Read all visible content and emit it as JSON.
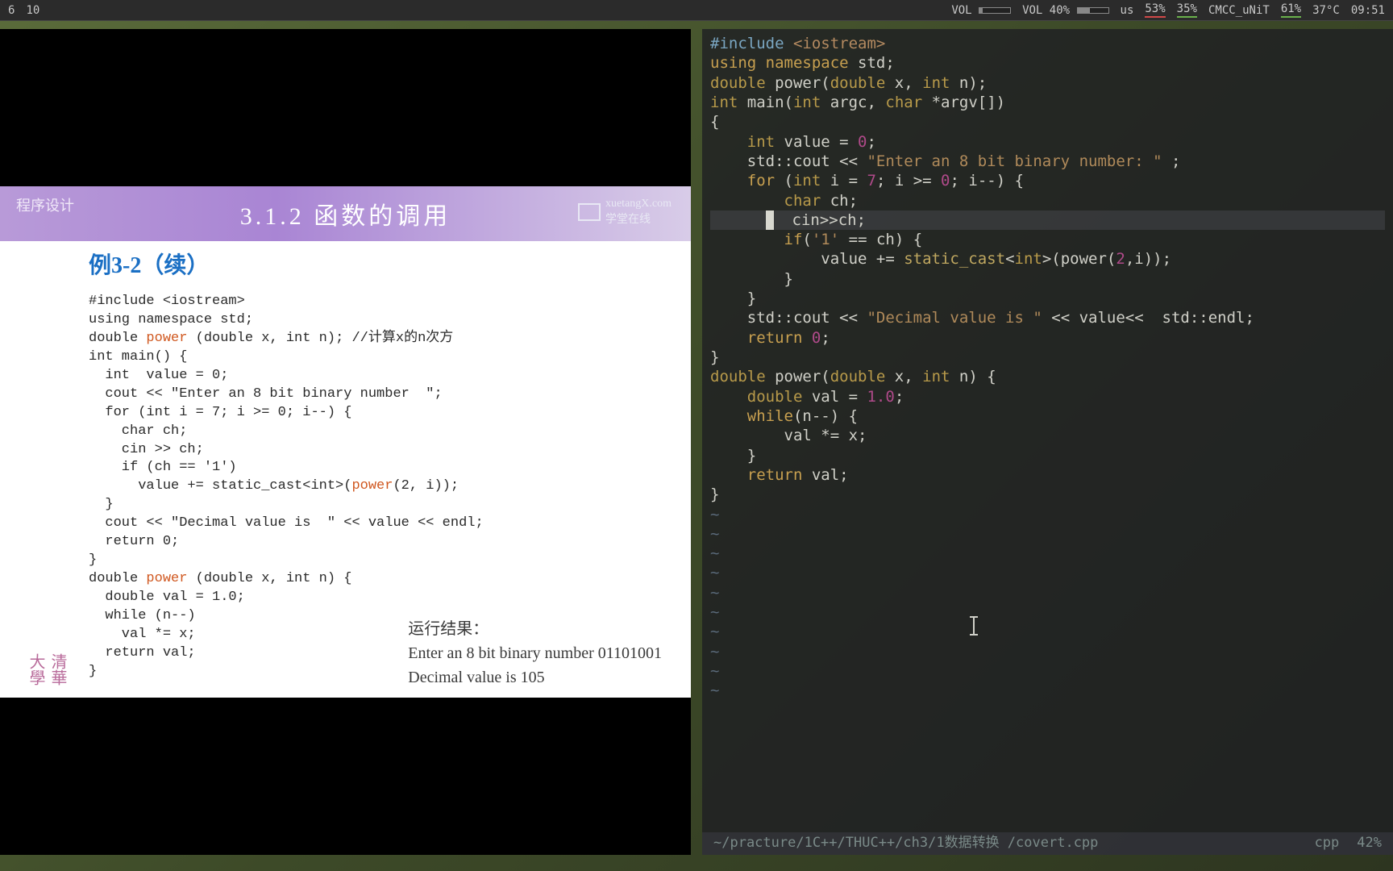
{
  "statusbar": {
    "workspace_current": "6",
    "workspace_count": "10",
    "vol_label": "VOL",
    "vol_pct_label": "VOL 40%",
    "kbd_layout": "us",
    "cpu_pct": "53%",
    "mem_pct": "35%",
    "net_name": "CMCC_uNiT",
    "batt_pct": "61%",
    "temp": "37°C",
    "clock": "09:51"
  },
  "slide": {
    "crumb": "程序设计",
    "title": "3.1.2 函数的调用",
    "logo_text": "xuetangX.com",
    "logo_cn": "学堂在线",
    "subtitle": "例3-2（续）",
    "code": [
      "#include <iostream>",
      "using namespace std;",
      "",
      "double power (double x, int n); //计算x的n次方",
      "",
      "int main() {",
      "  int  value = 0;",
      "  cout << \"Enter an 8 bit binary number  \";",
      "  for (int i = 7; i >= 0; i--) {",
      "    char ch;",
      "    cin >> ch;",
      "    if (ch == '1')",
      "      value += static_cast<int>(power(2, i));",
      "  }",
      "  cout << \"Decimal value is  \" << value << endl;",
      "  return 0;",
      "}",
      "",
      "double power (double x, int n) {",
      "  double val = 1.0;",
      "  while (n--)",
      "    val *= x;",
      "  return val;",
      "}"
    ],
    "result_label": "运行结果：",
    "result_line1": "Enter an 8 bit binary number  01101001",
    "result_line2": "Decimal value is  105",
    "uni": "清華大學"
  },
  "editor": {
    "cursor_line_index": 10,
    "lines": [
      [
        [
          "kw-pp",
          "#include "
        ],
        [
          "kw-inc",
          "<iostream>"
        ]
      ],
      [
        [
          "kw-key",
          "using "
        ],
        [
          "kw-key",
          "namespace "
        ],
        [
          "",
          "std;"
        ]
      ],
      [
        [
          "",
          ""
        ]
      ],
      [
        [
          "kw-type",
          "double "
        ],
        [
          "",
          "power("
        ],
        [
          "kw-type",
          "double"
        ],
        [
          "",
          "",
          " x, "
        ],
        [
          "kw-type",
          "int"
        ],
        [
          "",
          " n);"
        ]
      ],
      [
        [
          "",
          ""
        ]
      ],
      [
        [
          "kw-type",
          "int "
        ],
        [
          "",
          "main("
        ],
        [
          "kw-type",
          "int"
        ],
        [
          "",
          " argc, "
        ],
        [
          "kw-type",
          "char"
        ],
        [
          "",
          " *argv[])"
        ]
      ],
      [
        [
          "",
          "{"
        ]
      ],
      [
        [
          "",
          "    "
        ],
        [
          "kw-type",
          "int"
        ],
        [
          "",
          " value = "
        ],
        [
          "kw-num",
          "0"
        ],
        [
          "",
          ";"
        ]
      ],
      [
        [
          "",
          "    std::cout << "
        ],
        [
          "kw-str",
          "\"Enter an 8 bit binary number: \""
        ],
        [
          "",
          " ;"
        ]
      ],
      [
        [
          "",
          "    "
        ],
        [
          "kw-key",
          "for"
        ],
        [
          "",
          " ("
        ],
        [
          "kw-type",
          "int"
        ],
        [
          "",
          " i = "
        ],
        [
          "kw-num",
          "7"
        ],
        [
          "",
          "; i >= "
        ],
        [
          "kw-num",
          "0"
        ],
        [
          "",
          "; i--) {"
        ]
      ],
      [
        [
          "",
          "        "
        ],
        [
          "kw-type",
          "char"
        ],
        [
          "",
          " ch;"
        ]
      ],
      [
        [
          "",
          "        cin>>ch;"
        ]
      ],
      [
        [
          "",
          "        "
        ],
        [
          "kw-key",
          "if"
        ],
        [
          "",
          "("
        ],
        [
          "kw-str",
          "'1'"
        ],
        [
          "",
          " == ch) {"
        ]
      ],
      [
        [
          "",
          "            value += "
        ],
        [
          "kw-call",
          "static_cast"
        ],
        [
          "",
          "<"
        ],
        [
          "kw-type",
          "int"
        ],
        [
          "",
          ">(power("
        ],
        [
          "kw-num",
          "2"
        ],
        [
          "",
          ",i));"
        ]
      ],
      [
        [
          "",
          "        }"
        ]
      ],
      [
        [
          "",
          "    }"
        ]
      ],
      [
        [
          "",
          "    std::cout << "
        ],
        [
          "kw-str",
          "\"Decimal value is \""
        ],
        [
          "",
          " << value<<  std::endl;"
        ]
      ],
      [
        [
          "",
          ""
        ]
      ],
      [
        [
          "",
          "    "
        ],
        [
          "kw-key",
          "return"
        ],
        [
          "",
          " "
        ],
        [
          "kw-num",
          "0"
        ],
        [
          "",
          ";"
        ]
      ],
      [
        [
          "",
          "}"
        ]
      ],
      [
        [
          "",
          ""
        ]
      ],
      [
        [
          "kw-type",
          "double "
        ],
        [
          "",
          "power("
        ],
        [
          "kw-type",
          "double"
        ],
        [
          "",
          " x, "
        ],
        [
          "kw-type",
          "int"
        ],
        [
          "",
          " n) {"
        ]
      ],
      [
        [
          "",
          "    "
        ],
        [
          "kw-type",
          "double"
        ],
        [
          "",
          " val = "
        ],
        [
          "kw-num",
          "1.0"
        ],
        [
          "",
          ";"
        ]
      ],
      [
        [
          "",
          "    "
        ],
        [
          "kw-key",
          "while"
        ],
        [
          "",
          "(n--) {"
        ]
      ],
      [
        [
          "",
          "        val *= x;"
        ]
      ],
      [
        [
          "",
          "    }"
        ]
      ],
      [
        [
          "",
          "    "
        ],
        [
          "kw-key",
          "return"
        ],
        [
          "",
          " val;"
        ]
      ],
      [
        [
          "",
          "}"
        ]
      ]
    ],
    "tilde_count": 10,
    "status_path": " ~/practure/1C++/THUC++/ch3/1数据转换 /covert.cpp",
    "status_type": "cpp",
    "status_pct": "42%"
  }
}
